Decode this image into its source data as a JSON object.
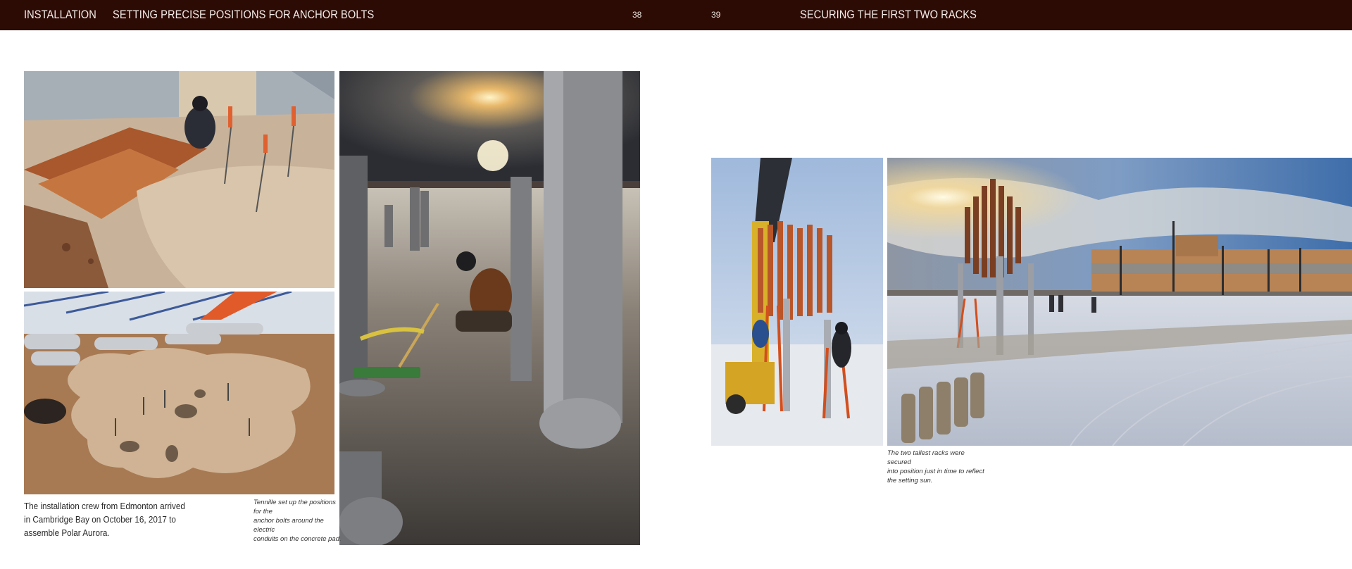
{
  "header": {
    "section": "INSTALLATION",
    "left_title": "SETTING PRECISE POSITIONS FOR ANCHOR BOLTS",
    "left_page": "38",
    "right_page": "39",
    "right_title": "SECURING THE FIRST TWO RACKS"
  },
  "captions": {
    "main": "The installation crew from Edmonton arrived in Cambridge Bay on October 16, 2017 to assemble Polar Aurora.",
    "tennille_line1": "Tennille set up the positions for the",
    "tennille_line2": "anchor bolts around the electric",
    "tennille_line3": "conduits on the concrete pad.",
    "racks_line1": "The two tallest racks were secured",
    "racks_line2": "into position just in time to reflect",
    "racks_line3": "the setting sun."
  },
  "colors": {
    "header_bg": "#2d0b05",
    "header_text": "#f3ece8"
  }
}
